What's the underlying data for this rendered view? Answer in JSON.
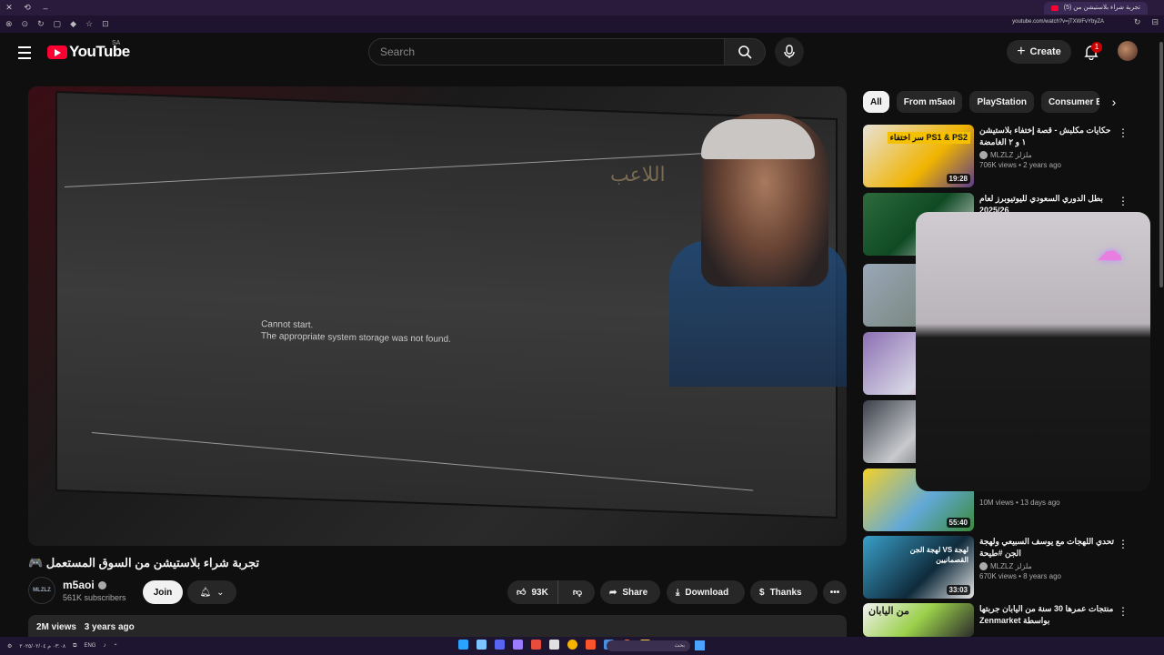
{
  "browser": {
    "tab_title": "(5) تجربة شراء بلاستيشن من",
    "url": "youtube.com/watch?v=jTXWFvYbyZA"
  },
  "masthead": {
    "logo_text": "YouTube",
    "country_code": "SA",
    "search_placeholder": "Search",
    "create_label": "Create",
    "notification_count": "1"
  },
  "player": {
    "screen_message_line1": "Cannot start.",
    "screen_message_line2": "The appropriate system storage was not found.",
    "arabic_overlay": "اللاعب"
  },
  "video": {
    "title": "تجربة شراء بلاستيشن من السوق المستعمل 🎮",
    "channel_name": "m5aoi",
    "channel_avatar_text": "MLZLZ",
    "subscribers": "561K subscribers",
    "join_label": "Join",
    "likes": "93K",
    "share_label": "Share",
    "download_label": "Download",
    "thanks_label": "Thanks",
    "views": "2M views",
    "age": "3 years ago"
  },
  "chips": [
    "All",
    "From m5aoi",
    "PlayStation",
    "Consumer E"
  ],
  "recommendations": [
    {
      "title": "حكايات مكلبش - قصة إختفاء بلاستيشن ١ و ٢ الغامضة",
      "channel": "MLZLZ ملزلز",
      "stats": "706K views • 2 years ago",
      "duration": "19:28",
      "thumb_text": "سر اختفاء PS1 & PS2"
    },
    {
      "title": "بطل الدوري السعودي لليوتيوبرز لعام 2025/26",
      "channel": "",
      "stats": "",
      "duration": "",
      "thumb_text": ""
    },
    {
      "title": "",
      "channel": "",
      "stats": "",
      "duration": "",
      "thumb_text": ""
    },
    {
      "title": "",
      "channel": "",
      "stats": "",
      "duration": "",
      "thumb_text": ""
    },
    {
      "title": "",
      "channel": "",
      "stats": "",
      "duration": "",
      "thumb_text": ""
    },
    {
      "title": "",
      "channel": "",
      "stats": "10M views • 13 days ago",
      "duration": "55:40",
      "thumb_text": ""
    },
    {
      "title": "تحدي اللهجات مع يوسف السبيعي ولهجة الجن #طيحة",
      "channel": "MLZLZ ملزلز",
      "stats": "670K views • 8 years ago",
      "duration": "33:03",
      "thumb_text": "لهجة الجن VS لهجة القصمانيين"
    },
    {
      "title": "منتجات عمرها 30 سنة من اليابان جربتها بواسطة Zenmarket",
      "channel": "",
      "stats": "",
      "duration": "",
      "thumb_text": "من اليابان"
    }
  ],
  "taskbar": {
    "time": "٠٣:٠٨ م",
    "date": "٢٠٢٥/٠٢/٠٤",
    "lang": "ENG",
    "search_text": "بحث"
  },
  "colors": {
    "youtube_red": "#ff0033",
    "background": "#0f0f0f",
    "chip_bg": "#272727"
  }
}
